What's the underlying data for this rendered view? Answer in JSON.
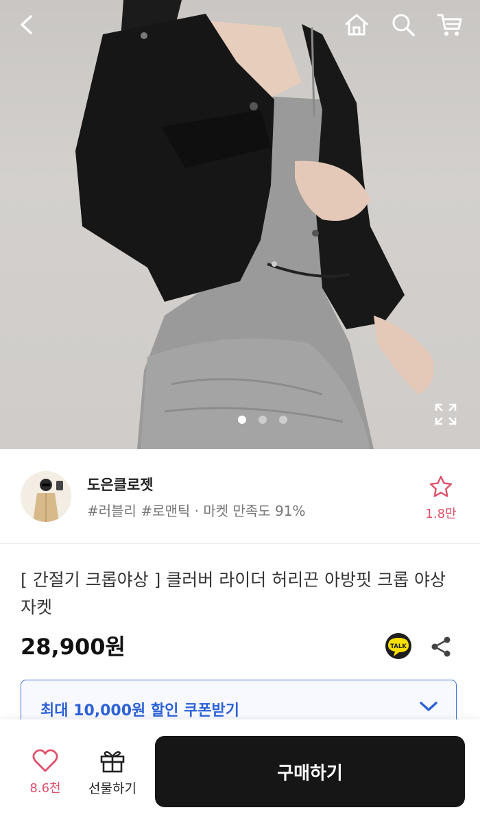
{
  "nav": {
    "back_icon": "back-arrow-icon",
    "home_icon": "home-icon",
    "search_icon": "search-icon",
    "cart_icon": "cart-icon"
  },
  "gallery": {
    "image_alt": "black cropped jacket over grey dress",
    "page_count": 3,
    "active_index": 0,
    "expand_icon": "expand-icon"
  },
  "seller": {
    "name": "도은클로젯",
    "tags": "#러블리 #로맨틱 · 마켓 만족도 91%",
    "favorite_count": "1.8만",
    "favorite_icon": "star-outline-icon"
  },
  "product": {
    "title": "[ 간절기 크롭야상 ] 클러버 라이더 허리끈 아방핏 크롭 야상 자켓",
    "price": "28,900원",
    "talk_label": "TALK"
  },
  "coupon": {
    "label": "최대 10,000원 할인 쿠폰받기"
  },
  "bottom_bar": {
    "like_count": "8.6천",
    "gift_label": "선물하기",
    "buy_label": "구매하기"
  },
  "colors": {
    "accent_pink": "#e0506a",
    "coupon_blue": "#2d62d6",
    "buy_button": "#161616",
    "kakao_yellow": "#f9e000"
  }
}
